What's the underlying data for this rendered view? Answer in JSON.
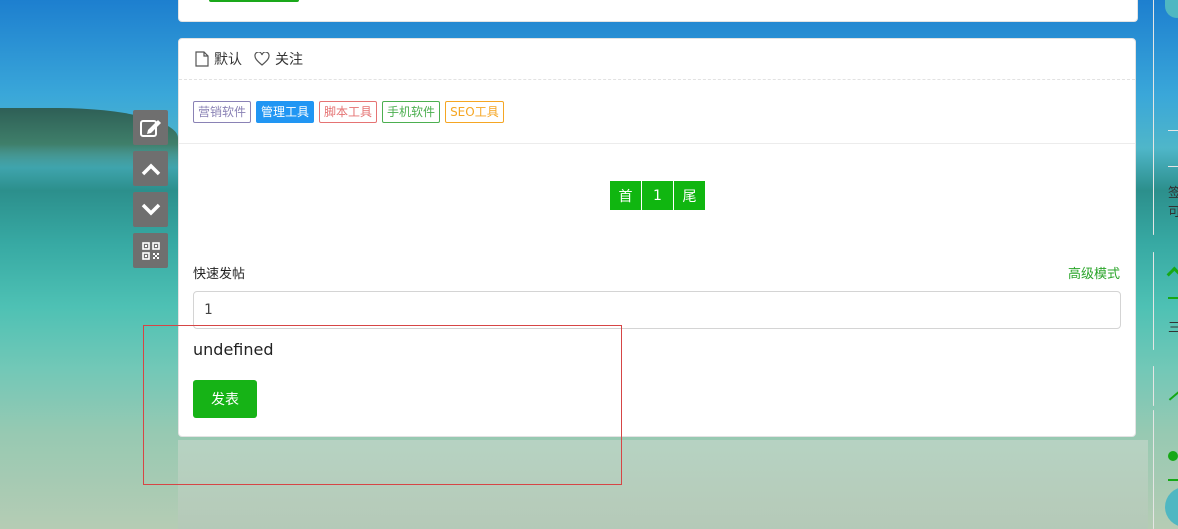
{
  "tabs": [
    {
      "label": "默认",
      "icon": "file-icon"
    },
    {
      "label": "关注",
      "icon": "heart-icon"
    }
  ],
  "tags": [
    {
      "label": "营销软件",
      "color": "#8a82b5",
      "active": false
    },
    {
      "label": "管理工具",
      "color": "#2196f3",
      "active": true
    },
    {
      "label": "脚本工具",
      "color": "#e57373",
      "active": false
    },
    {
      "label": "手机软件",
      "color": "#4caf50",
      "active": false
    },
    {
      "label": "SEO工具",
      "color": "#f5a623",
      "active": false
    }
  ],
  "pagination": {
    "first": "首",
    "current": "1",
    "last": "尾"
  },
  "quick_post": {
    "label": "快速发帖",
    "advanced_link": "高级模式",
    "input_value": "1",
    "message": "undefined",
    "submit_label": "发表"
  },
  "side_tools": [
    "edit-icon",
    "arrow-up-icon",
    "arrow-down-icon",
    "qrcode-icon"
  ],
  "right_panel": {
    "text1": "签",
    "text2": "可",
    "text3": "三"
  },
  "colors": {
    "accent_green": "#10b610",
    "link_green": "#2aa52a"
  }
}
